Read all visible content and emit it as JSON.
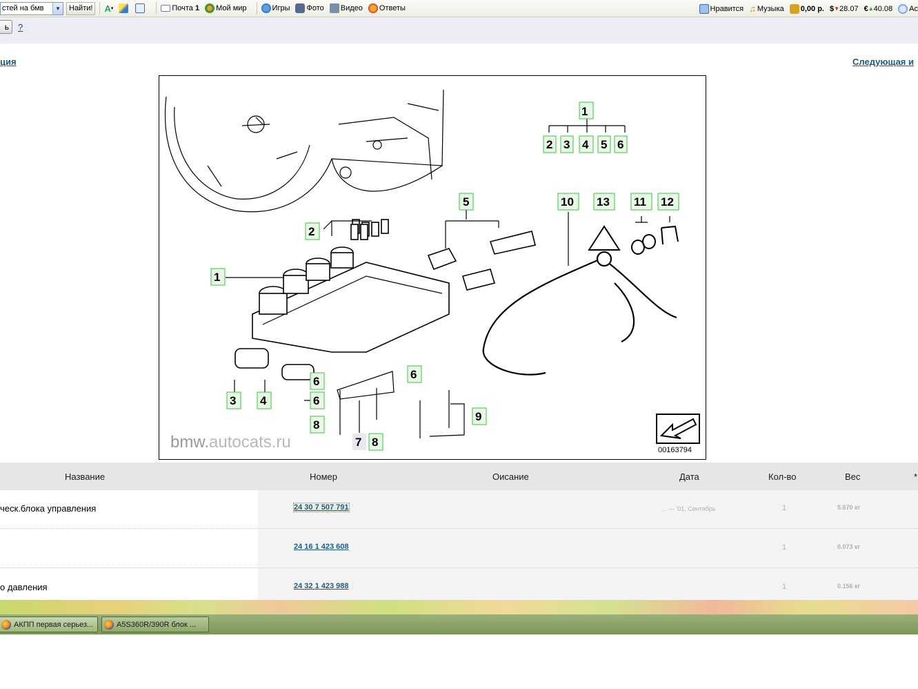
{
  "toolbar": {
    "search_value": "стей на бмв",
    "find_label": "Найти!",
    "items": [
      {
        "icon": "mail-icon",
        "label": "Почта",
        "badge": "1"
      },
      {
        "icon": "my-world-icon",
        "label": "Мой мир"
      },
      {
        "icon": "games-icon",
        "label": "Игры"
      },
      {
        "icon": "photo-icon",
        "label": "Фото"
      },
      {
        "icon": "video-icon",
        "label": "Видео"
      },
      {
        "icon": "answers-icon",
        "label": "Ответы"
      }
    ],
    "right": {
      "like_label": "Нравится",
      "music_label": "Музыка",
      "balance": "0,00 р.",
      "usd": "28.07",
      "eur": "40.08",
      "last_label": "Ас"
    }
  },
  "subbar": {
    "button_label": "ь",
    "help_label": "?"
  },
  "nav": {
    "prev_label": "ция",
    "next_label": "Следующая и"
  },
  "diagram": {
    "watermark_main": "bmw.",
    "watermark_rest": "autocats.ru",
    "image_code": "00163794",
    "callouts": [
      "1",
      "2",
      "3",
      "4",
      "5",
      "6",
      "2",
      "5",
      "1",
      "3",
      "4",
      "6",
      "6",
      "6",
      "8",
      "7",
      "8",
      "9",
      "10",
      "13",
      "11",
      "12"
    ]
  },
  "table": {
    "headers": {
      "name": "Название",
      "number": "Номер",
      "description": "Оисание",
      "date": "Дата",
      "qty": "Кол-во",
      "weight": "Вес",
      "extra": "*"
    },
    "rows": [
      {
        "name": "ческ.блока управления",
        "number": "24 30 7 507 791",
        "date": "... — '01, Сентябрь",
        "qty": "1",
        "weight": "5.670 кг"
      },
      {
        "name": "",
        "number": "24 16 1 423 608",
        "date": "",
        "qty": "1",
        "weight": "0.073 кг"
      },
      {
        "name": "о давления",
        "number": "24 32 1 423 988",
        "date": "",
        "qty": "1",
        "weight": "0.156 кг"
      }
    ]
  },
  "taskbar": {
    "tasks": [
      {
        "label": "АКПП первая серьез..."
      },
      {
        "label": "A5S360R/390R блок ..."
      }
    ]
  },
  "colors": {
    "callout_fill": "#e9f7e6",
    "callout_border": "#38c93d",
    "link": "#1e5a86",
    "header_bg": "#e6e6e6"
  }
}
